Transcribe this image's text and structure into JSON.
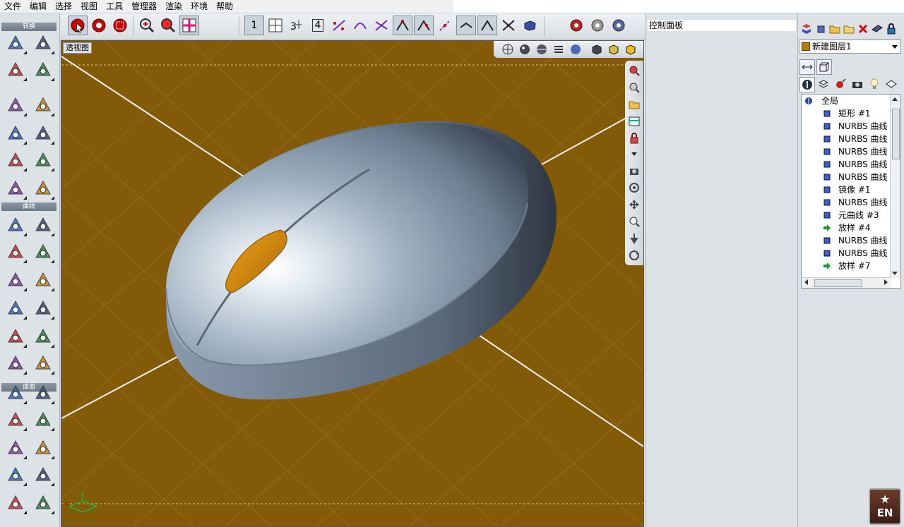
{
  "menu": [
    "文件",
    "编辑",
    "选择",
    "视图",
    "工具",
    "管理器",
    "渲染",
    "环境",
    "帮助"
  ],
  "left_sections": [
    "转换",
    "曲线",
    "曲面"
  ],
  "viewport": {
    "label": "透视图"
  },
  "control_panel": {
    "title": "控制面板"
  },
  "layers": {
    "current": "新建图层1",
    "swatch_color": "#b87a0a"
  },
  "tree": {
    "root": "全局",
    "items": [
      "矩形 #1",
      "NURBS 曲线",
      "NURBS 曲线",
      "NURBS 曲线",
      "NURBS 曲线",
      "NURBS 曲线",
      "镜像 #1",
      "NURBS 曲线",
      "元曲线 #3",
      "放样 #4",
      "NURBS 曲线",
      "NURBS 曲线",
      "放样 #7"
    ]
  },
  "toolbar_groups": [
    "1",
    "4"
  ],
  "language_badge": "EN",
  "colors": {
    "viewport_bg": "#835a07",
    "model": "#a4b4c4",
    "button": "#d18d0a"
  }
}
